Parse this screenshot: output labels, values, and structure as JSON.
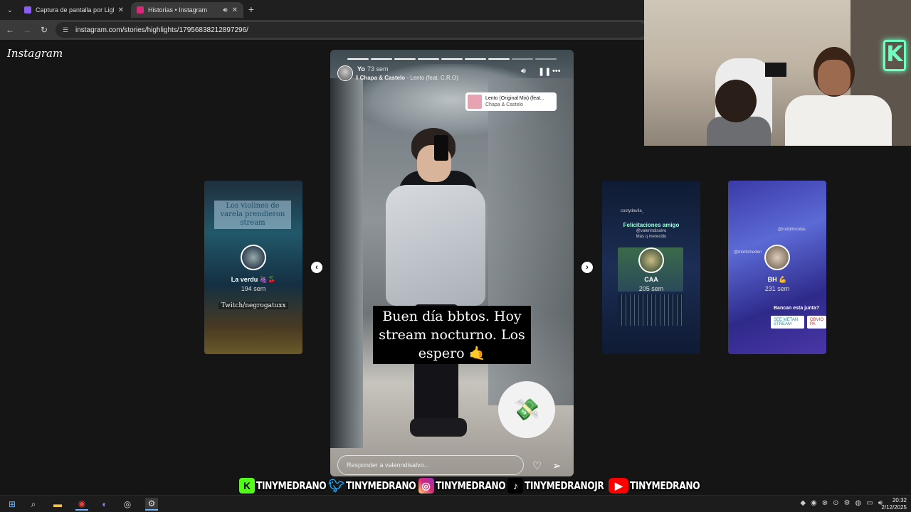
{
  "browser": {
    "tabs": [
      {
        "title": "Captura de pantalla por Lightsh",
        "favicon_color": "#8a5cf6"
      },
      {
        "title": "Historias • Instagram",
        "favicon_color": "#d62976"
      }
    ],
    "url": "instagram.com/stories/highlights/17956838212897296/"
  },
  "instagram": {
    "logo": "Instagram",
    "main_story": {
      "user": "Yo",
      "time_ago": "73 sem",
      "music_artist": "Chapa & Castelo",
      "music_track": " - Lento (feat. C.R.O)",
      "sticker_song": "Lento (Original Mix) (feat...",
      "sticker_artist": "Chapa & Castelo",
      "caption": "Buen día bbtos. Hoy stream nocturno. Los espero 🤙",
      "reply_placeholder": "Responder a valenndisalvo...",
      "progress_total": 9,
      "progress_done": 7
    },
    "side_stories": [
      {
        "top_text": "Los violines de varela prendieron stream",
        "name": "La verdu 🍇🍒",
        "ago": "194 sem",
        "sub": "Twitch/negrogatuxx"
      },
      {
        "headline": "Felicitaciones amigo",
        "handle": "@valenndisalvo",
        "note": "Más q merecido",
        "poster": "costydavila_",
        "name": "CAA",
        "ago": "205 sem"
      },
      {
        "name": "BH 💪",
        "ago": "231 sem",
        "question": "Bancan esta junta?",
        "btn1": "SEE METAN STREAM",
        "btn2": "OBVIO PA",
        "tag1": "@roddrincolas",
        "tag2": "@mortisheden"
      }
    ]
  },
  "socials": {
    "kick": "TINYMEDRANO",
    "twitter": "TINYMEDRANO",
    "instagram": "TINYMEDRANO",
    "tiktok": "TINYMEDRANOJR",
    "youtube": "TINYMEDRANO"
  },
  "taskbar": {
    "time": "20:32",
    "date": "2/12/2025"
  }
}
